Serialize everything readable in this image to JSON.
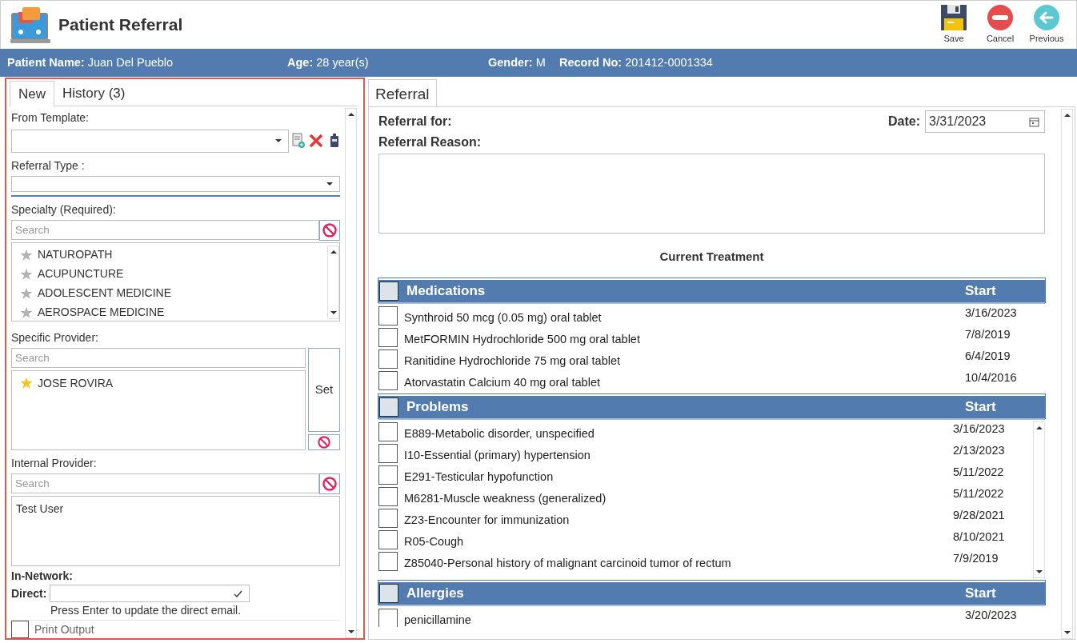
{
  "window": {
    "title": "Patient Referral"
  },
  "toolbar": [
    {
      "label": "Save",
      "kind": "save"
    },
    {
      "label": "Cancel",
      "kind": "cancel"
    },
    {
      "label": "Previous",
      "kind": "previous"
    }
  ],
  "patient_bar": [
    {
      "label": "Patient Name:",
      "value": "Juan Del Pueblo"
    },
    {
      "label": "Age:",
      "value": "28 year(s)"
    },
    {
      "label": "Gender:",
      "value": "M"
    },
    {
      "label": "Record No:",
      "value": "201412-0001334"
    }
  ],
  "left_tabs": [
    {
      "label": "New",
      "selected": true
    },
    {
      "label": "History",
      "count": "(3)",
      "selected": false
    }
  ],
  "form": {
    "from_template_label": "From Template:",
    "referral_type_label": "Referral Type :",
    "specialty": {
      "label": "Specialty (Required):",
      "placeholder": "Search",
      "items": [
        {
          "name": "NATUROPATH",
          "favorite": false
        },
        {
          "name": "ACUPUNCTURE",
          "favorite": false
        },
        {
          "name": "ADOLESCENT MEDICINE",
          "favorite": false
        },
        {
          "name": "AEROSPACE MEDICINE",
          "favorite": false
        }
      ]
    },
    "specific_provider": {
      "label": "Specific Provider:",
      "placeholder": "Search",
      "set_button": "Set",
      "items": [
        {
          "name": "JOSE ROVIRA",
          "favorite": true
        }
      ]
    },
    "internal_provider": {
      "label": "Internal Provider:",
      "placeholder": "Search",
      "items": [
        "Test User"
      ]
    },
    "in_network_label": "In-Network:",
    "direct_label": "Direct:",
    "direct_hint": "Press Enter to update the direct email.",
    "print_output": {
      "label": "Print Output",
      "checked": false
    }
  },
  "right_tabs": [
    {
      "label": "Referral",
      "selected": true
    }
  ],
  "referral": {
    "for_label": "Referral for:",
    "reason_label": "Referral Reason:",
    "date_label": "Date:",
    "date": "3/31/2023",
    "treatment_title": "Current Treatment",
    "sections": [
      {
        "title": "Medications",
        "start_label": "Start",
        "checked": false,
        "scroll": false,
        "items": [
          {
            "name": "Synthroid 50 mcg (0.05 mg) oral tablet",
            "start": "3/16/2023",
            "checked": false
          },
          {
            "name": "MetFORMIN Hydrochloride 500 mg oral tablet",
            "start": "7/8/2019",
            "checked": false
          },
          {
            "name": "Ranitidine Hydrochloride 75 mg oral tablet",
            "start": "6/4/2019",
            "checked": false
          },
          {
            "name": "Atorvastatin Calcium 40 mg oral tablet",
            "start": "10/4/2016",
            "checked": false
          }
        ]
      },
      {
        "title": "Problems",
        "start_label": "Start",
        "checked": false,
        "scroll": true,
        "items": [
          {
            "name": "E889-Metabolic disorder, unspecified",
            "start": "3/16/2023",
            "checked": false
          },
          {
            "name": "I10-Essential (primary) hypertension",
            "start": "2/13/2023",
            "checked": false
          },
          {
            "name": "E291-Testicular hypofunction",
            "start": "5/11/2022",
            "checked": false
          },
          {
            "name": "M6281-Muscle weakness (generalized)",
            "start": "5/11/2022",
            "checked": false
          },
          {
            "name": "Z23-Encounter for immunization",
            "start": "9/28/2021",
            "checked": false
          },
          {
            "name": "R05-Cough",
            "start": "8/10/2021",
            "checked": false
          },
          {
            "name": "Z85040-Personal history of malignant carcinoid tumor of rectum",
            "start": "7/9/2019",
            "checked": false
          }
        ]
      },
      {
        "title": "Allergies",
        "start_label": "Start",
        "checked": false,
        "scroll": false,
        "items": [
          {
            "name": "penicillamine",
            "start": "3/20/2023",
            "checked": false
          }
        ]
      }
    ]
  }
}
